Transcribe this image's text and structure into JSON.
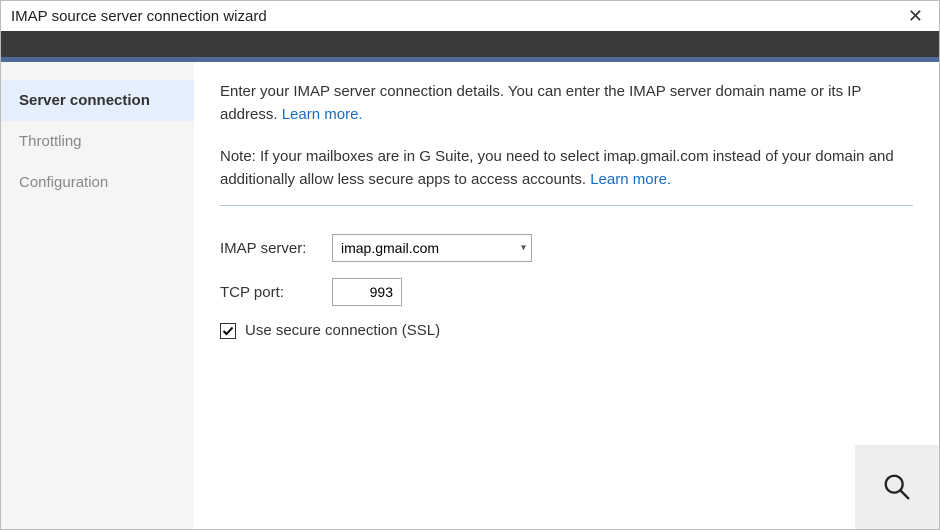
{
  "window": {
    "title": "IMAP source server connection wizard",
    "close_label": "✕"
  },
  "sidebar": {
    "items": [
      {
        "label": "Server connection",
        "active": true
      },
      {
        "label": "Throttling",
        "active": false
      },
      {
        "label": "Configuration",
        "active": false
      }
    ]
  },
  "main": {
    "intro_text": "Enter your IMAP server connection details. You can enter the IMAP server domain name or its IP address. ",
    "intro_link": "Learn more.",
    "note_prefix": "Note: If your mailboxes are in G Suite, you need to select imap.gmail.com instead of your domain and additionally allow less secure apps to access accounts. ",
    "note_link": "Learn more."
  },
  "form": {
    "imap_label": "IMAP server:",
    "imap_value": "imap.gmail.com",
    "port_label": "TCP port:",
    "port_value": "993",
    "ssl_label": "Use secure connection (SSL)",
    "ssl_checked": true
  },
  "icons": {
    "search": "search-icon"
  }
}
